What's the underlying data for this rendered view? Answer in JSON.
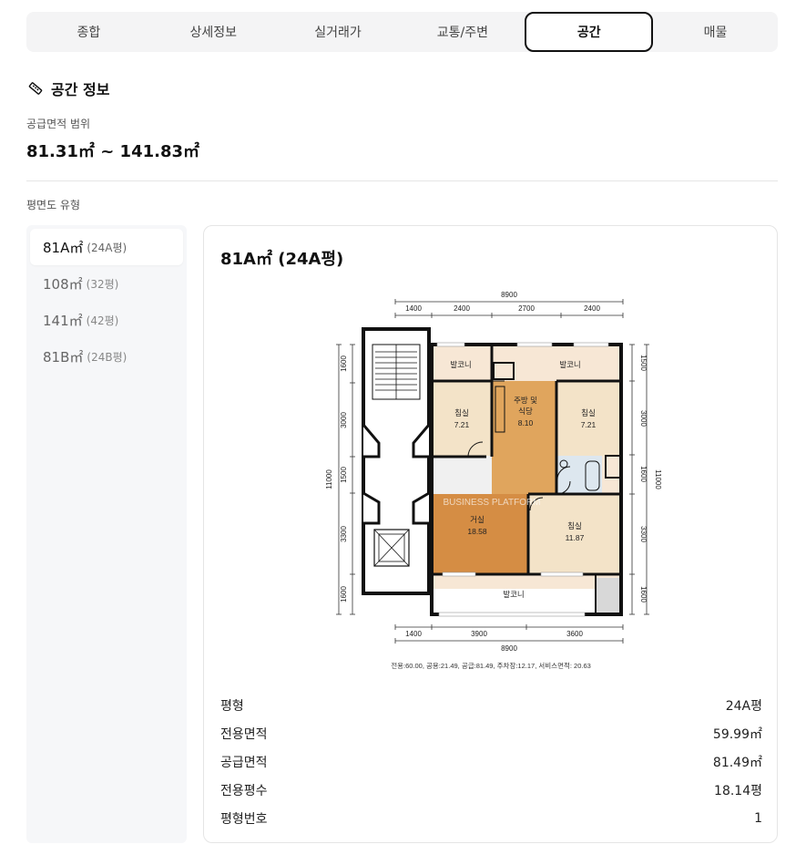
{
  "tabs": [
    "종합",
    "상세정보",
    "실거래가",
    "교통/주변",
    "공간",
    "매물"
  ],
  "active_tab_index": 4,
  "section": {
    "title": "공간 정보",
    "icon": "ruler-icon"
  },
  "supply_range": {
    "label": "공급면적 범위",
    "value": "81.31㎡ ~ 141.83㎡"
  },
  "floorplan_types": {
    "label": "평면도 유형",
    "items": [
      {
        "main": "81A㎡",
        "sub": "(24A평)"
      },
      {
        "main": "108㎡",
        "sub": "(32평)"
      },
      {
        "main": "141㎡",
        "sub": "(42평)"
      },
      {
        "main": "81B㎡",
        "sub": "(24B평)"
      }
    ],
    "active_index": 0
  },
  "detail": {
    "title": "81A㎡ (24A평)",
    "plan": {
      "top_total": "8900",
      "top_dims": [
        "1400",
        "2400",
        "2700",
        "2400"
      ],
      "bottom_dims": [
        "1400",
        "3900",
        "3600"
      ],
      "bottom_total": "8900",
      "left_dims": [
        "1600",
        "3000",
        "1500",
        "3300",
        "1600"
      ],
      "right_dims": [
        "1500",
        "3000",
        "1600",
        "3300",
        "1600"
      ],
      "height_total": "11000",
      "rooms": {
        "balcony_1": "발코니",
        "balcony_2": "발코니",
        "balcony_3": "발코니",
        "bedroom_1": "침실",
        "bedroom_1_area": "7.21",
        "kitchen": "주방 및",
        "kitchen_2": "식당",
        "kitchen_area": "8.10",
        "bedroom_2": "침실",
        "bedroom_2_area": "7.21",
        "living": "거실",
        "living_area": "18.58",
        "bedroom_3": "침실",
        "bedroom_3_area": "11.87"
      },
      "watermark": "BUSINESS PLATFORM",
      "caption": "전용:60.00, 공용:21.49, 공급:81.49, 주차장:12.17, 서비스면적: 20.63"
    },
    "rows": [
      {
        "label": "평형",
        "value": "24A평"
      },
      {
        "label": "전용면적",
        "value": "59.99㎡"
      },
      {
        "label": "공급면적",
        "value": "81.49㎡"
      },
      {
        "label": "전용평수",
        "value": "18.14평"
      },
      {
        "label": "평형번호",
        "value": "1"
      }
    ]
  }
}
